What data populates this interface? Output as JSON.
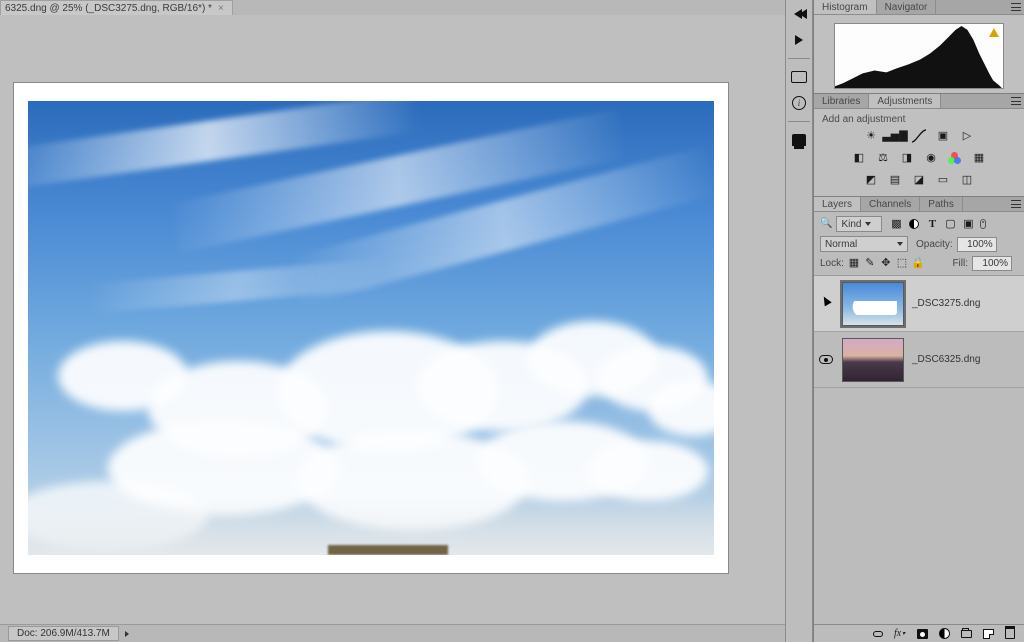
{
  "document": {
    "tab_title": "6325.dng @ 25% (_DSC3275.dng, RGB/16*) *",
    "statusbar": "Doc: 206.9M/413.7M"
  },
  "panels": {
    "histogram": {
      "tabs": [
        "Histogram",
        "Navigator"
      ],
      "active": 0
    },
    "libraries": {
      "tabs": [
        "Libraries",
        "Adjustments"
      ],
      "active": 1,
      "subtitle": "Add an adjustment"
    },
    "layers": {
      "tabs": [
        "Layers",
        "Channels",
        "Paths"
      ],
      "active": 0
    }
  },
  "layer_opts": {
    "filter_label": "Kind",
    "blend_mode": "Normal",
    "opacity_label": "Opacity:",
    "opacity_value": "100%",
    "lock_label": "Lock:",
    "fill_label": "Fill:",
    "fill_value": "100%"
  },
  "layers": [
    {
      "name": "_DSC3275.dng",
      "visible": false,
      "selected": true,
      "thumb": "sky"
    },
    {
      "name": "_DSC6325.dng",
      "visible": true,
      "selected": false,
      "thumb": "land"
    }
  ],
  "layer_footer_icons": [
    "link",
    "fx",
    "mask",
    "adjustment",
    "folder",
    "new",
    "trash"
  ]
}
